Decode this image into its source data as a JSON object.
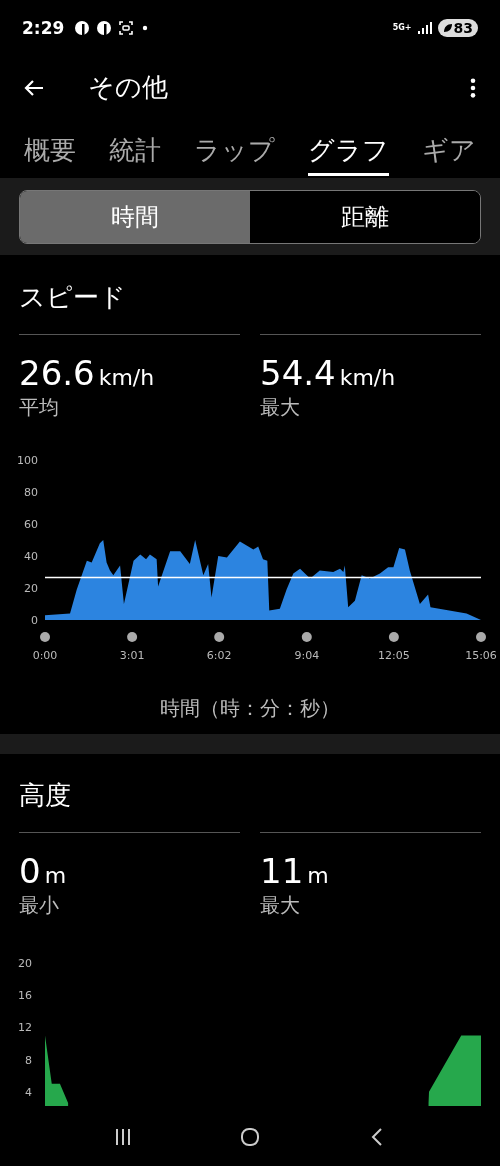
{
  "status_bar": {
    "time": "2:29",
    "network": "5G+",
    "battery": "83"
  },
  "app_bar": {
    "title": "その他"
  },
  "tabs": [
    {
      "label": "概要",
      "selected": false
    },
    {
      "label": "統計",
      "selected": false
    },
    {
      "label": "ラップ",
      "selected": false
    },
    {
      "label": "グラフ",
      "selected": true
    },
    {
      "label": "ギア",
      "selected": false
    }
  ],
  "segments": [
    {
      "label": "時間",
      "selected": true
    },
    {
      "label": "距離",
      "selected": false
    }
  ],
  "sections": [
    {
      "title": "スピード",
      "stats": [
        {
          "value": "26.6",
          "unit": "km/h",
          "label": "平均"
        },
        {
          "value": "54.4",
          "unit": "km/h",
          "label": "最大"
        }
      ],
      "chart_data": {
        "type": "area",
        "xlabel": "時間（時：分：秒）",
        "xlim": [
          0,
          906
        ],
        "ylim": [
          0,
          100
        ],
        "x": [
          0,
          52,
          66,
          87,
          97,
          114,
          121,
          128,
          135,
          142,
          156,
          164,
          184,
          198,
          210,
          218,
          232,
          235,
          260,
          281,
          301,
          312,
          322,
          329,
          339,
          346,
          360,
          378,
          405,
          433,
          443,
          453,
          462,
          466,
          488,
          502,
          516,
          530,
          551,
          571,
          599,
          613,
          620,
          623,
          630,
          644,
          658,
          675,
          696,
          713,
          724,
          736,
          748,
          758,
          779,
          796,
          801,
          876,
          906
        ],
        "series": [
          {
            "color": "#2c84e0",
            "values": [
              3,
              4,
              19,
              37,
              36,
              48,
              50,
              36,
              31,
              28,
              34,
              10,
              37,
              41,
              38,
              41,
              38,
              21,
              43,
              43,
              35,
              50,
              37,
              28,
              35,
              14,
              40,
              39,
              49,
              44,
              46,
              38,
              37,
              6,
              7,
              19,
              29,
              32,
              26,
              31,
              30,
              32,
              30,
              34,
              8,
              12,
              28,
              26,
              29,
              33,
              33,
              45,
              44,
              31,
              10,
              16,
              8,
              4,
              0
            ]
          },
          {
            "type": "line",
            "color": "#ffffff",
            "values": [
              26.6,
              26.6,
              26.6,
              26.6,
              26.6,
              26.6,
              26.6,
              26.6,
              26.6,
              26.6,
              26.6,
              26.6,
              26.6,
              26.6,
              26.6,
              26.6,
              26.6,
              26.6,
              26.6,
              26.6,
              26.6,
              26.6,
              26.6,
              26.6,
              26.6,
              26.6,
              26.6,
              26.6,
              26.6,
              26.6,
              26.6,
              26.6,
              26.6,
              26.6,
              26.6,
              26.6,
              26.6,
              26.6,
              26.6,
              26.6,
              26.6,
              26.6,
              26.6,
              26.6,
              26.6,
              26.6,
              26.6,
              26.6,
              26.6,
              26.6,
              26.6,
              26.6,
              26.6,
              26.6,
              26.6,
              26.6,
              26.6,
              26.6,
              26.6
            ]
          }
        ],
        "xticks": [
          {
            "value": 0,
            "label": "0:00"
          },
          {
            "value": 181,
            "label": "3:01"
          },
          {
            "value": 362,
            "label": "6:02"
          },
          {
            "value": 544,
            "label": "9:04"
          },
          {
            "value": 725,
            "label": "12:05"
          },
          {
            "value": 906,
            "label": "15:06"
          }
        ],
        "yticks": [
          0,
          20,
          40,
          60,
          80,
          100
        ]
      }
    },
    {
      "title": "高度",
      "stats": [
        {
          "value": "0",
          "unit": "m",
          "label": "最小"
        },
        {
          "value": "11",
          "unit": "m",
          "label": "最大"
        }
      ],
      "chart_data": {
        "type": "area",
        "xlim": [
          0,
          906
        ],
        "ylim": [
          0,
          20
        ],
        "x": [
          0,
          14,
          31,
          48,
          52,
          797,
          798,
          865,
          906
        ],
        "series": [
          {
            "color": "#26a84c",
            "values": [
              11,
              5,
              5,
              2.6,
              null,
              2.6,
              4,
              11,
              11
            ]
          }
        ],
        "yticks": [
          4,
          8,
          12,
          16,
          20
        ]
      }
    }
  ]
}
